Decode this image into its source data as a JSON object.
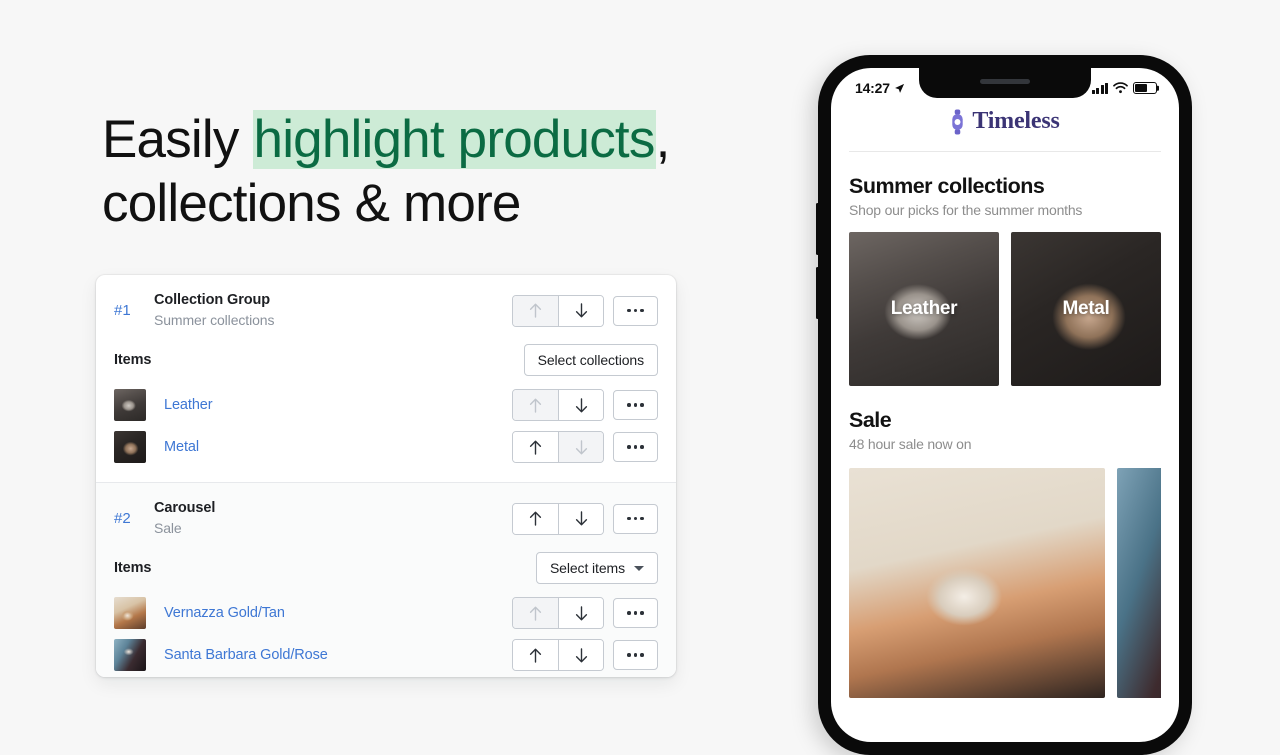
{
  "headline": {
    "line1_plain": "Easily ",
    "line1_mark": "highlight products",
    "line1_tail": ",",
    "line2": "collections & more",
    "mark_bg": "#cdebd6",
    "mark_fg": "#0b6b43"
  },
  "editor": {
    "sections": [
      {
        "rank": "#1",
        "title": "Collection Group",
        "subtitle": "Summer collections",
        "move_up_enabled": false,
        "move_down_enabled": true,
        "items_label": "Items",
        "select_label": "Select collections",
        "select_has_caret": false,
        "items": [
          {
            "name": "Leather",
            "thumb": "watch-leather-thumb",
            "move_up_enabled": false,
            "move_down_enabled": true
          },
          {
            "name": "Metal",
            "thumb": "watch-metal-thumb",
            "move_up_enabled": true,
            "move_down_enabled": false
          }
        ]
      },
      {
        "rank": "#2",
        "title": "Carousel",
        "subtitle": "Sale",
        "move_up_enabled": true,
        "move_down_enabled": true,
        "items_label": "Items",
        "select_label": "Select items",
        "select_has_caret": true,
        "items": [
          {
            "name": "Vernazza Gold/Tan",
            "thumb": "watch-vernazza-thumb",
            "move_up_enabled": false,
            "move_down_enabled": true
          },
          {
            "name": "Santa Barbara Gold/Rose",
            "thumb": "watch-santa-thumb",
            "move_up_enabled": true,
            "move_down_enabled": true
          }
        ]
      }
    ],
    "link_color": "#3e77d4"
  },
  "phone": {
    "status": {
      "time": "14:27",
      "location_icon": "location-arrow-icon",
      "signal_icon": "cellular-signal-icon",
      "wifi_icon": "wifi-icon",
      "battery_icon": "battery-icon"
    },
    "shop": {
      "logo_icon": "watch-logo-icon",
      "logo_text": "Timeless",
      "logo_color": "#3b3475",
      "blocks": [
        {
          "title": "Summer collections",
          "subtitle": "Shop our picks for the summer months",
          "tiles": [
            {
              "label": "Leather",
              "image": "watch-leather-photo"
            },
            {
              "label": "Metal",
              "image": "watch-metal-photo"
            }
          ]
        },
        {
          "title": "Sale",
          "subtitle": "48 hour sale now on",
          "slides": [
            {
              "image": "watch-sale-photo-1"
            },
            {
              "image": "watch-sale-photo-2"
            }
          ]
        }
      ]
    }
  }
}
